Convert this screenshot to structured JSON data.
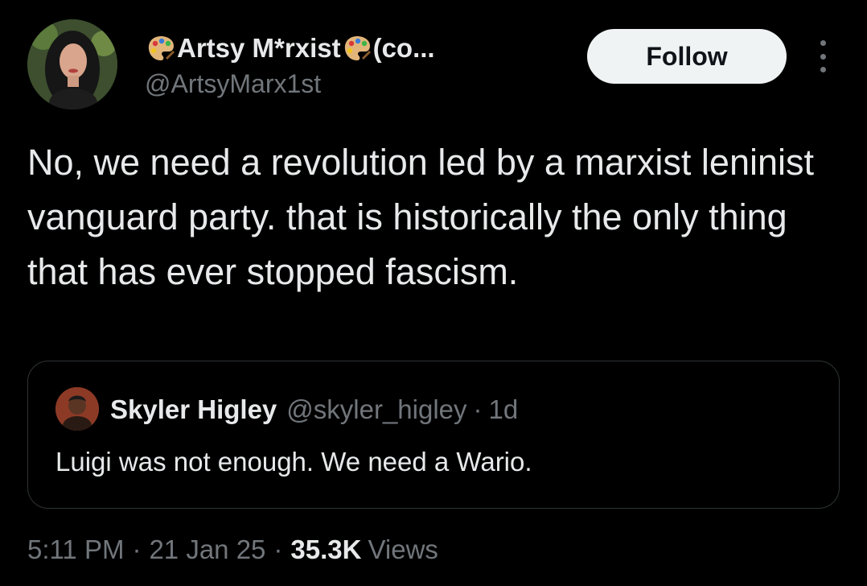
{
  "author": {
    "display_name": "Artsy M*rxist",
    "name_suffix": "(co...",
    "name_icon": "artist-palette-icon",
    "handle": "@ArtsyMarx1st"
  },
  "follow_button": {
    "label": "Follow"
  },
  "more_menu": {
    "icon": "more-vertical-icon"
  },
  "tweet": {
    "text": "No, we need a revolution led by a marxist leninist vanguard party. that is historically the only thing that has ever stopped fascism."
  },
  "quote": {
    "display_name": "Skyler Higley",
    "handle": "@skyler_higley",
    "separator": "·",
    "time": "1d",
    "text": "Luigi was not enough. We need a Wario."
  },
  "meta": {
    "time": "5:11 PM",
    "separator": "·",
    "date": "21 Jan 25",
    "views_count": "35.3K",
    "views_label": "Views"
  },
  "colors": {
    "background": "#000000",
    "text_primary": "#e7e9ea",
    "text_secondary": "#71767b",
    "border": "#2f3336",
    "follow_button_bg": "#eff3f4"
  }
}
